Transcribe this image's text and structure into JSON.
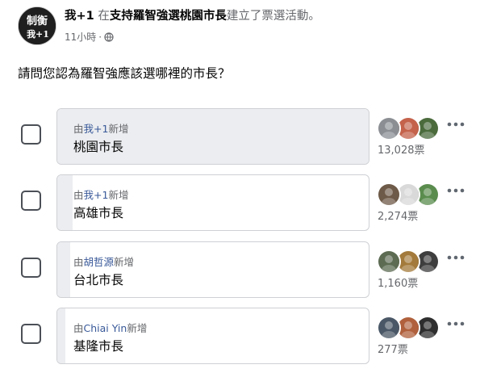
{
  "post": {
    "author": "我+1",
    "action_prefix": " 在",
    "group": "支持羅智強選桃園市長",
    "action_suffix": "建立了票選活動。",
    "time": "11小時",
    "separator": "·",
    "avatar_text_top": "制衡",
    "avatar_text_bottom": "我+1",
    "privacy_icon": "globe-icon"
  },
  "poll": {
    "question": "請問您認為羅智強應該選哪裡的市長？",
    "options": [
      {
        "added_prefix": "由",
        "added_by": "我+1",
        "added_suffix": "新增",
        "label": "桃園市長",
        "votes": 13028,
        "votes_text": "13,028票",
        "share": 1.0,
        "voter_colors": [
          "#8b8f94",
          "#c4624b",
          "#4b6b3c"
        ]
      },
      {
        "added_prefix": "由",
        "added_by": "我+1",
        "added_suffix": "新增",
        "label": "高雄市長",
        "votes": 2274,
        "votes_text": "2,274票",
        "share": 0.05,
        "voter_colors": [
          "#6e5a48",
          "#d9d9d9",
          "#5a8c4e"
        ]
      },
      {
        "added_prefix": "由",
        "added_by": "胡哲源",
        "added_suffix": "新增",
        "label": "台北市長",
        "votes": 1160,
        "votes_text": "1,160票",
        "share": 0.04,
        "voter_colors": [
          "#5c6b52",
          "#a37a3b",
          "#3e3e3e"
        ]
      },
      {
        "added_prefix": "由",
        "added_by": "Chiai Yin",
        "added_suffix": "新增",
        "label": "基隆市長",
        "votes": 277,
        "votes_text": "277票",
        "share": 0.01,
        "voter_colors": [
          "#4a5766",
          "#b0603c",
          "#2e2e2e"
        ]
      }
    ],
    "more_icon": "more-options-icon"
  },
  "colors": {
    "link": "#385898",
    "secondary_text": "#65676b",
    "fill": "#ebedf0",
    "border": "#ced0d4"
  }
}
